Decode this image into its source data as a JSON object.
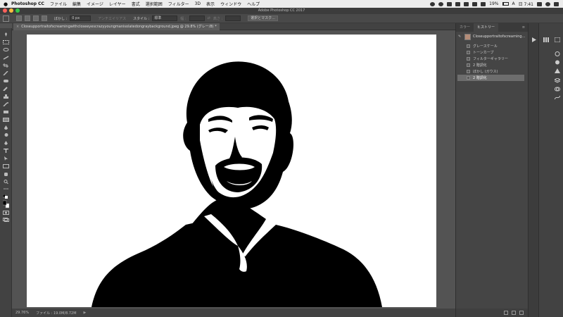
{
  "menubar": {
    "apple_label": "",
    "app_name": "Photoshop CC",
    "menu": [
      "ファイル",
      "編集",
      "イメージ",
      "レイヤー",
      "書式",
      "選択範囲",
      "フィルター",
      "3D",
      "表示",
      "ウィンドウ",
      "ヘルプ"
    ],
    "battery": "19%",
    "input_method": "A",
    "clock": "日 7:41"
  },
  "window": {
    "title": "Adobe Photoshop CC 2017"
  },
  "options": {
    "feather_label": "ぼかし :",
    "feather_value": "0 px",
    "antialias_label": "アンチエイリアス",
    "style_label": "スタイル :",
    "style_value": "標準",
    "width_label": "幅 :",
    "height_label": "高さ :",
    "mask_button": "選択とマスク..."
  },
  "document": {
    "tab_close": "×",
    "tab_title": "Closeupportraitofscreamingwithcloseeyescrazyyoungmanisolatedongraybackground.jpeg @ 29.8% (グレー/8) *"
  },
  "status": {
    "zoom": "29.76%",
    "file_info": "ファイル : 19.0M/8.72M"
  },
  "panel": {
    "tabs": [
      "カラー",
      "ヒストリー"
    ],
    "active_tab": "ヒストリー",
    "snapshot_name": "Closeupportraitofscreaming...",
    "history": [
      {
        "label": "グレースケール"
      },
      {
        "label": "トーンカーブ"
      },
      {
        "label": "フィルターギャラリー"
      },
      {
        "label": "2 階調化"
      },
      {
        "label": "ぼかし (ガウス)"
      },
      {
        "label": "2 階調化"
      }
    ],
    "selected_index": 5
  },
  "colors": {
    "ui_bg": "#535353",
    "panel_bg": "#454545",
    "selected": "#6d6d6d",
    "close_light": "#fc605c",
    "min_light": "#fdbc40",
    "max_light": "#34c84a"
  }
}
